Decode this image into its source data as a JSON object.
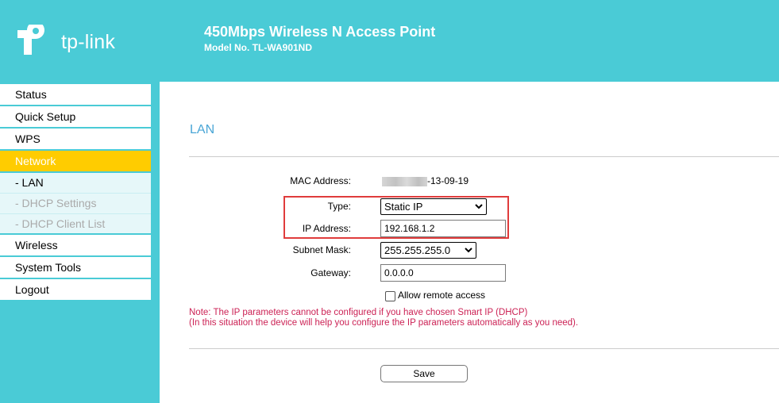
{
  "header": {
    "logo_text": "tp-link",
    "product_title": "450Mbps Wireless N Access Point",
    "model_no": "Model No. TL-WA901ND"
  },
  "menu": {
    "status": "Status",
    "quick_setup": "Quick Setup",
    "wps": "WPS",
    "network": "Network",
    "lan": "- LAN",
    "dhcp_settings": "- DHCP Settings",
    "dhcp_client_list": "- DHCP Client List",
    "wireless": "Wireless",
    "system_tools": "System Tools",
    "logout": "Logout"
  },
  "page": {
    "title": "LAN",
    "mac_label": "MAC Address:",
    "mac_value": "-13-09-19",
    "type_label": "Type:",
    "type_value": "Static IP",
    "ip_label": "IP Address:",
    "ip_value": "192.168.1.2",
    "subnet_label": "Subnet Mask:",
    "subnet_value": "255.255.255.0",
    "gateway_label": "Gateway:",
    "gateway_value": "0.0.0.0",
    "allow_remote_label": "Allow remote access",
    "allow_remote_checked": false,
    "note_line1": "Note: The IP parameters cannot be configured if you have chosen Smart IP (DHCP)",
    "note_line2": "(In this situation the device will help you configure the IP parameters automatically as you need).",
    "save_label": "Save"
  },
  "colors": {
    "header_bg": "#4acbd6",
    "active_menu": "#ffcc00",
    "title_blue": "#4aa6d6",
    "note_red": "#cc2255",
    "highlight_red": "#e03c3c"
  },
  "icons": {
    "logo": "tp-link-logo-icon",
    "dropdown": "chevron-down-icon"
  }
}
